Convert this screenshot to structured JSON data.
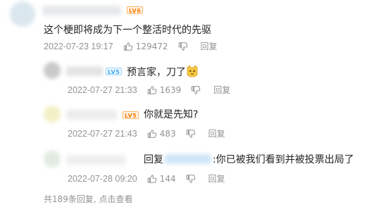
{
  "comments": [
    {
      "badge": "LV6",
      "badge_color": "orange",
      "text": "这个梗即将成为下一个整活时代的先驱",
      "time": "2022-07-23 19:17",
      "likes": "129472",
      "reply_label": "回复"
    },
    {
      "badge": "LV5",
      "badge_color": "blue",
      "text": "预言家，刀了",
      "emoji": "cat-face-icon",
      "time": "2022-07-27 21:33",
      "likes": "1639",
      "reply_label": "回复"
    },
    {
      "badge": "LV5",
      "badge_color": "orange",
      "text": "你就是先知?",
      "time": "2022-07-27 21:43",
      "likes": "483",
      "reply_label": "回复"
    },
    {
      "reply_prefix": "回复",
      "text": ":你已被我们看到并被投票出局了",
      "time": "2022-07-28 09:20",
      "likes": "144",
      "reply_label": "回复"
    }
  ],
  "more_replies": "共189条回复, 点击查看",
  "colors": {
    "badge_orange": "#ff7a00",
    "badge_blue": "#3fa9f5",
    "meta_gray": "#939393"
  }
}
